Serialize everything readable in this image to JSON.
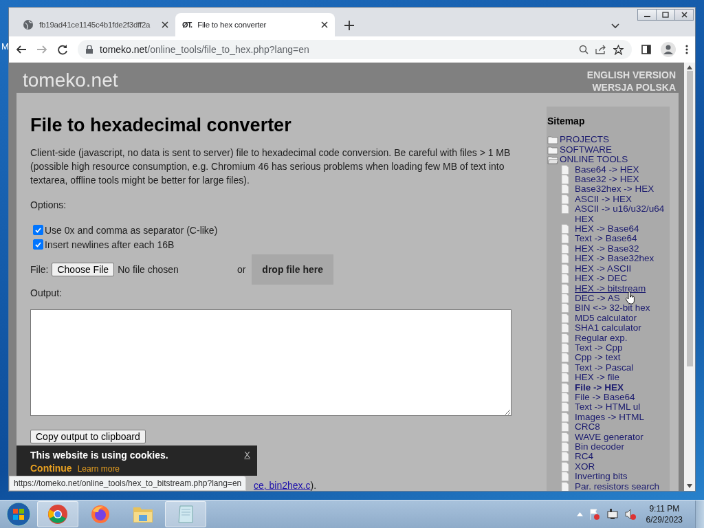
{
  "desktop": {
    "label": "M"
  },
  "tabs": [
    {
      "title": "fb19ad41ce1145c4b1fde2f3dff2a",
      "selected": false
    },
    {
      "title": "File to hex converter",
      "favicon_text": "ØT.",
      "selected": true
    }
  ],
  "address_bar": {
    "host": "tomeko.net",
    "path": "/online_tools/file_to_hex.php?lang=en"
  },
  "site": {
    "logo": "tomeko.net",
    "languages": [
      {
        "label": "ENGLISH VERSION"
      },
      {
        "label": "WERSJA POLSKA"
      }
    ]
  },
  "main": {
    "title": "File to hexadecimal converter",
    "description": "Client-side (javascript, no data is sent to server) file to hexadecimal code conversion. Be careful with files > 1 MB (possible high resource consumption, e.g. Chromium 46 has serious problems when loading few MB of text into textarea, offline tools might be better for large files).",
    "options_label": "Options:",
    "options": [
      {
        "label": "Use 0x and comma as separator (C-like)",
        "checked": true
      },
      {
        "label": "Insert newlines after each 16B",
        "checked": true
      }
    ],
    "file_label": "File:",
    "choose_button": "Choose File",
    "file_status": "No file chosen",
    "or": "or",
    "drop_zone": "drop file here",
    "output_label": "Output:",
    "copy_button": "Copy output to clipboard",
    "footer_link": "ce, bin2hex.c",
    "footer_tail": ")."
  },
  "sitemap": {
    "title": "Sitemap",
    "items": [
      {
        "label": "PROJECTS",
        "expanded": false
      },
      {
        "label": "SOFTWARE",
        "expanded": false
      },
      {
        "label": "ONLINE TOOLS",
        "expanded": true,
        "children": [
          {
            "label": "Base64 -> HEX",
            "selected": false,
            "hovered": false
          },
          {
            "label": "Base32 -> HEX",
            "selected": false,
            "hovered": false
          },
          {
            "label": "Base32hex -> HEX",
            "selected": false,
            "hovered": false
          },
          {
            "label": "ASCII -> HEX",
            "selected": false,
            "hovered": false
          },
          {
            "label": "ASCII -> u16/u32/u64 HEX",
            "selected": false,
            "hovered": false
          },
          {
            "label": "HEX -> Base64",
            "selected": false,
            "hovered": false
          },
          {
            "label": "Text -> Base64",
            "selected": false,
            "hovered": false
          },
          {
            "label": "HEX -> Base32",
            "selected": false,
            "hovered": false
          },
          {
            "label": "HEX -> Base32hex",
            "selected": false,
            "hovered": false
          },
          {
            "label": "HEX -> ASCII",
            "selected": false,
            "hovered": false
          },
          {
            "label": "HEX -> DEC",
            "selected": false,
            "hovered": false
          },
          {
            "label": "HEX -> bitstream",
            "selected": false,
            "hovered": true
          },
          {
            "label": "DEC -> AS",
            "selected": false,
            "hovered": false
          },
          {
            "label": "BIN <-> 32-bit hex",
            "selected": false,
            "hovered": false
          },
          {
            "label": "MD5 calculator",
            "selected": false,
            "hovered": false
          },
          {
            "label": "SHA1 calculator",
            "selected": false,
            "hovered": false
          },
          {
            "label": "Regular exp.",
            "selected": false,
            "hovered": false
          },
          {
            "label": "Text -> Cpp",
            "selected": false,
            "hovered": false
          },
          {
            "label": "Cpp -> text",
            "selected": false,
            "hovered": false
          },
          {
            "label": "Text -> Pascal",
            "selected": false,
            "hovered": false
          },
          {
            "label": "HEX -> file",
            "selected": false,
            "hovered": false
          },
          {
            "label": "File -> HEX",
            "selected": true,
            "hovered": false
          },
          {
            "label": "File -> Base64",
            "selected": false,
            "hovered": false
          },
          {
            "label": "Text -> HTML ul",
            "selected": false,
            "hovered": false
          },
          {
            "label": "Images -> HTML",
            "selected": false,
            "hovered": false
          },
          {
            "label": "CRC8",
            "selected": false,
            "hovered": false
          },
          {
            "label": "WAVE generator",
            "selected": false,
            "hovered": false
          },
          {
            "label": "Bin decoder",
            "selected": false,
            "hovered": false
          },
          {
            "label": "RC4",
            "selected": false,
            "hovered": false
          },
          {
            "label": "XOR",
            "selected": false,
            "hovered": false
          },
          {
            "label": "Inverting bits",
            "selected": false,
            "hovered": false
          },
          {
            "label": "Par. resistors search",
            "selected": false,
            "hovered": false
          }
        ]
      }
    ]
  },
  "cookie_banner": {
    "message": "This website is using cookies.",
    "close": "X",
    "continue": "Continue",
    "learn_more": "Learn more"
  },
  "status_tooltip": "https://tomeko.net/online_tools/hex_to_bitstream.php?lang=en",
  "taskbar": {
    "apps": [
      {
        "kind": "chrome",
        "selected": true
      },
      {
        "kind": "firefox",
        "selected": false
      },
      {
        "kind": "explorer",
        "selected": false
      },
      {
        "kind": "notepad",
        "selected": true
      }
    ],
    "clock": {
      "time": "9:11 PM",
      "date": "6/29/2023"
    }
  }
}
